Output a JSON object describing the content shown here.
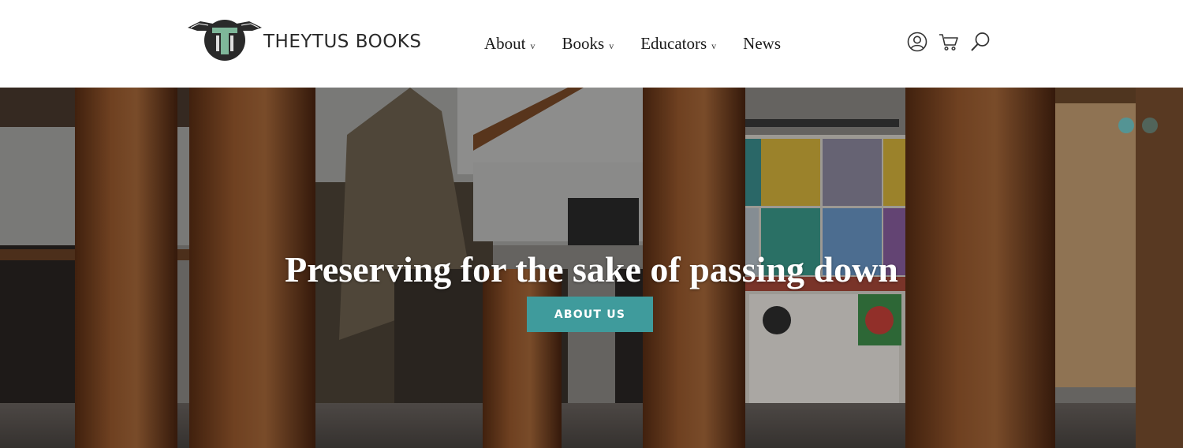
{
  "brand": {
    "name": "THEYTUS BOOKS",
    "logo_icon": "theytus-logo-icon",
    "accent": "#3f9b9c"
  },
  "nav": {
    "items": [
      {
        "label": "About",
        "caret": "v"
      },
      {
        "label": "Books",
        "caret": "v"
      },
      {
        "label": "Educators",
        "caret": "v"
      },
      {
        "label": "News",
        "caret": ""
      }
    ]
  },
  "utility_icons": [
    "account-icon",
    "cart-icon",
    "search-icon"
  ],
  "hero": {
    "headline": "Preserving for the sake of passing down",
    "cta_label": "ABOUT US",
    "slides": {
      "count": 2,
      "active": 1
    }
  }
}
